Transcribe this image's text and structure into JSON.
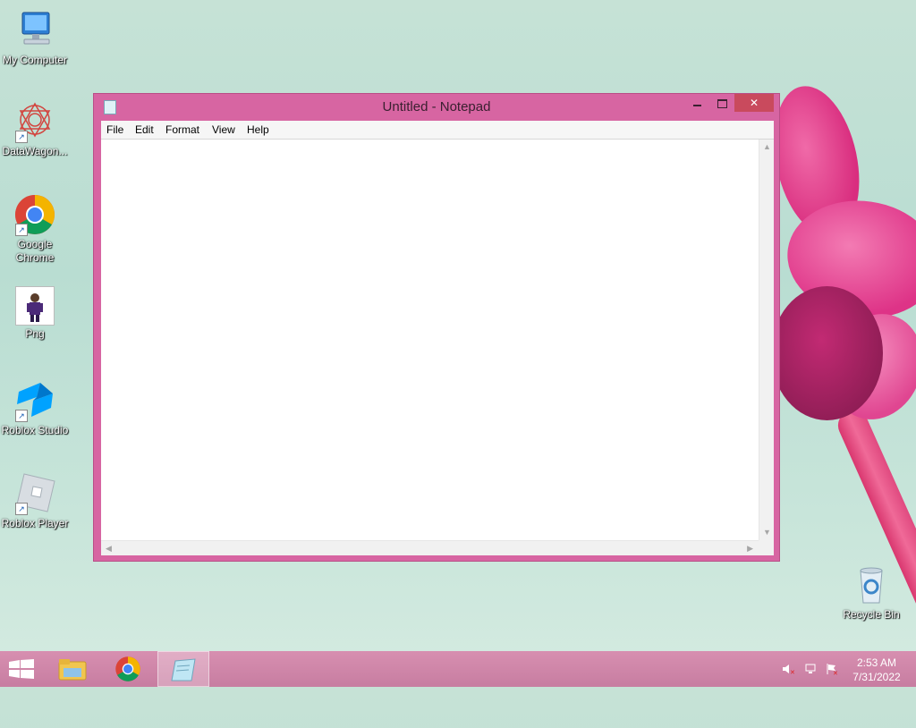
{
  "desktop": {
    "icons": [
      {
        "label": "My Computer",
        "icon": "computer-icon",
        "shortcut": false
      },
      {
        "label": "DataWagon...",
        "icon": "datawagon-icon",
        "shortcut": true
      },
      {
        "label": "Google Chrome",
        "icon": "chrome-icon",
        "shortcut": true
      },
      {
        "label": "Png",
        "icon": "image-file-icon",
        "shortcut": false
      },
      {
        "label": "Roblox Studio",
        "icon": "roblox-studio-icon",
        "shortcut": true
      },
      {
        "label": "Roblox Player",
        "icon": "roblox-player-icon",
        "shortcut": true
      },
      {
        "label": "Recycle Bin",
        "icon": "recycle-bin-icon",
        "shortcut": false
      }
    ]
  },
  "notepad": {
    "title": "Untitled - Notepad",
    "menu": [
      "File",
      "Edit",
      "Format",
      "View",
      "Help"
    ],
    "content": "",
    "controls": {
      "minimize": "minimize",
      "maximize": "maximize",
      "close": "close"
    }
  },
  "taskbar": {
    "items": [
      {
        "name": "start",
        "icon": "windows-logo-icon"
      },
      {
        "name": "file-explorer",
        "icon": "folder-icon"
      },
      {
        "name": "chrome",
        "icon": "chrome-icon"
      },
      {
        "name": "notepad",
        "icon": "notepad-icon",
        "active": true
      }
    ],
    "tray": [
      "volume-muted-icon",
      "network-icon",
      "action-center-flag-icon"
    ],
    "time": "2:53 AM",
    "date": "7/31/2022"
  },
  "colors": {
    "window_frame": "#d765a2",
    "close_button": "#c94a5d",
    "taskbar": "#cb82a5"
  }
}
